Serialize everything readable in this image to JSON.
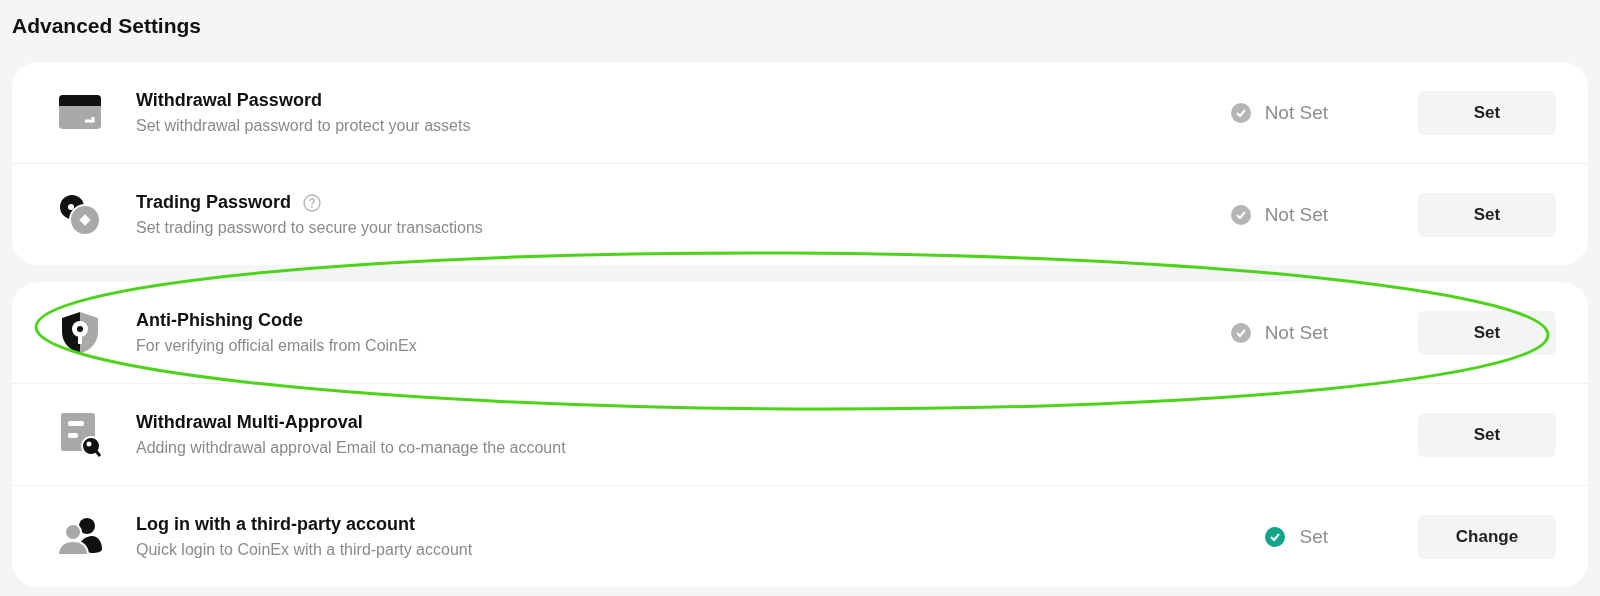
{
  "title": "Advanced Settings",
  "groups": [
    {
      "items": [
        {
          "title": "Withdrawal Password",
          "help": false,
          "description": "Set withdrawal password to protect your assets",
          "status": {
            "label": "Not Set",
            "done": false
          },
          "button": "Set"
        },
        {
          "title": "Trading Password",
          "help": true,
          "description": "Set trading password to secure your transactions",
          "status": {
            "label": "Not Set",
            "done": false
          },
          "button": "Set"
        }
      ]
    },
    {
      "items": [
        {
          "title": "Anti-Phishing Code",
          "help": false,
          "description": "For verifying official emails from CoinEx",
          "status": {
            "label": "Not Set",
            "done": false
          },
          "button": "Set"
        },
        {
          "title": "Withdrawal Multi-Approval",
          "help": false,
          "description": "Adding withdrawal approval Email to co-manage the account",
          "button": "Set"
        },
        {
          "title": "Log in with a third-party account",
          "help": false,
          "description": "Quick login to CoinEx with a third-party account",
          "status": {
            "label": "Set",
            "done": true
          },
          "button": "Change"
        }
      ]
    }
  ],
  "annotation": {
    "kind": "ellipse",
    "color": "#4cd31a"
  }
}
